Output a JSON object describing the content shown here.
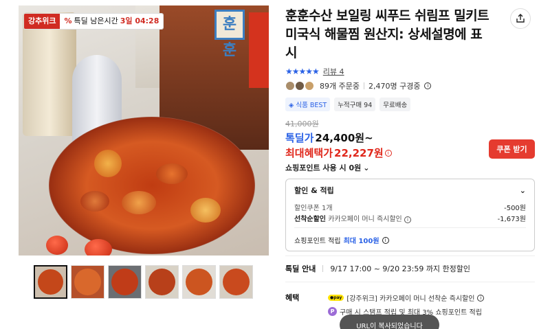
{
  "badge": {
    "brand": "강추위크",
    "pct": "%",
    "label": "특딜 남은시간",
    "time": "3일 04:28"
  },
  "package": {
    "logo": "훈훈"
  },
  "product": {
    "title": "훈훈수산 보일링 씨푸드 쉬림프 밀키트 미국식 해물찜 원산지: 상세설명에 표시"
  },
  "rating": {
    "stars": "★★★★★",
    "review": "리뷰 4"
  },
  "stats": {
    "orders": "89개 주문중",
    "subscribers": "2,470명 구경중"
  },
  "tags": [
    "식품 BEST",
    "누적구매 94",
    "무료배송"
  ],
  "price": {
    "original": "41,000원",
    "label": "톡딜가",
    "value": "24,400원~",
    "max_label": "최대혜택가",
    "max_value": "22,227원"
  },
  "coupon": {
    "label": "쿠폰 받기"
  },
  "points": {
    "label": "쇼핑포인트 사용 시 0원"
  },
  "discount": {
    "title": "할인 & 적립",
    "coupon_k": "할인쿠폰 1개",
    "coupon_v": "-500원",
    "first_k": "선착순할인",
    "first_sub": "카카오페이 머니 즉시할인",
    "first_v": "-1,673원",
    "point_k": "쇼핑포인트 적립",
    "point_v": "최대 100원"
  },
  "sale": {
    "k": "톡딜 안내",
    "v": "9/17 17:00 ~ 9/20 23:59 까지 한정할인"
  },
  "benefit": {
    "k": "혜택",
    "b1": "[강주위크] 카카오페이 머니 선착순 즉시할인",
    "b2": "구매 시 스탬프 적립 및 최대 3% 쇼핑포인트 적립"
  },
  "toast": "URL이 복사되었습니다",
  "colors": {
    "accent": "#2b62e6",
    "red": "#e0281c"
  }
}
